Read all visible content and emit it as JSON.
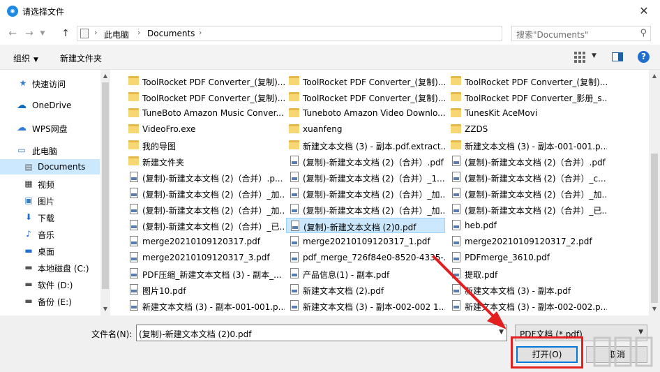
{
  "window": {
    "title": "请选择文件",
    "close_label": "✕"
  },
  "address": {
    "back_icon": "arrow-left-icon",
    "forward_icon": "arrow-right-icon",
    "recent_icon": "chevron-down-icon",
    "up_icon": "arrow-up-icon",
    "crumbs": [
      "此电脑",
      "Documents"
    ],
    "refresh_icon": "refresh-icon"
  },
  "search": {
    "placeholder": "搜索\"Documents\""
  },
  "toolbar": {
    "organize_label": "组织",
    "new_folder_label": "新建文件夹"
  },
  "nav": {
    "items": [
      {
        "label": "快速访问",
        "icon": "star-icon"
      },
      {
        "label": "OneDrive",
        "icon": "cloud-icon"
      },
      {
        "label": "WPS网盘",
        "icon": "cloud-icon"
      },
      {
        "label": "此电脑",
        "icon": "computer-icon"
      },
      {
        "label": "Documents",
        "icon": "document-icon"
      },
      {
        "label": "视频",
        "icon": "video-icon"
      },
      {
        "label": "图片",
        "icon": "picture-icon"
      },
      {
        "label": "下载",
        "icon": "download-icon"
      },
      {
        "label": "音乐",
        "icon": "music-icon"
      },
      {
        "label": "桌面",
        "icon": "desktop-icon"
      },
      {
        "label": "本地磁盘 (C:)",
        "icon": "drive-icon"
      },
      {
        "label": "软件 (D:)",
        "icon": "drive-icon"
      },
      {
        "label": "备份 (E:)",
        "icon": "drive-icon"
      }
    ],
    "selected": "Documents"
  },
  "files": {
    "columns": [
      [
        {
          "name": "ToolRocket PDF Converter_(复制)...",
          "type": "folder"
        },
        {
          "name": "ToolRocket PDF Converter_(复制)...",
          "type": "folder"
        },
        {
          "name": "TuneBoto Amazon Music Conver...",
          "type": "folder"
        },
        {
          "name": "VideoFro.exe",
          "type": "folder"
        },
        {
          "name": "我的导图",
          "type": "folder"
        },
        {
          "name": "新建文件夹",
          "type": "folder"
        },
        {
          "name": "(复制)-新建文本文档 (2)（合并）.p...",
          "type": "pdf"
        },
        {
          "name": "(复制)-新建文本文档 (2)（合并）_加...",
          "type": "pdf"
        },
        {
          "name": "(复制)-新建文本文档 (2)（合并）_加...",
          "type": "pdf"
        },
        {
          "name": "(复制)-新建文本文档 (2)（合并）_已...",
          "type": "pdf"
        },
        {
          "name": "merge20210109120317.pdf",
          "type": "pdf"
        },
        {
          "name": "merge20210109120317_3.pdf",
          "type": "pdf"
        },
        {
          "name": "PDF压缩_新建文本文档 (3) - 副本_...",
          "type": "pdf"
        },
        {
          "name": "图片10.pdf",
          "type": "pdf"
        },
        {
          "name": "新建文本文档 (3) - 副本-001-001.p...",
          "type": "pdf"
        }
      ],
      [
        {
          "name": "ToolRocket PDF Converter_(复制)...",
          "type": "folder"
        },
        {
          "name": "ToolRocket PDF Converter_(复制)...",
          "type": "folder"
        },
        {
          "name": "Tuneboto Amazon Video Downlo...",
          "type": "folder"
        },
        {
          "name": "xuanfeng",
          "type": "folder"
        },
        {
          "name": "新建文本文档 (3) - 副本.pdf.extract...",
          "type": "folder"
        },
        {
          "name": "(复制)-新建文本文档 (2)（合并）.pdf",
          "type": "pdf"
        },
        {
          "name": "(复制)-新建文本文档 (2)（合并）_1...",
          "type": "pdf"
        },
        {
          "name": "(复制)-新建文本文档 (2)（合并）_加...",
          "type": "pdf"
        },
        {
          "name": "(复制)-新建文本文档 (2)（合并）_加...",
          "type": "pdf"
        },
        {
          "name": "(复制)-新建文本文档 (2)0.pdf",
          "type": "pdf"
        },
        {
          "name": "merge20210109120317_1.pdf",
          "type": "pdf"
        },
        {
          "name": "pdf_merge_726f84e0-8520-4335-...",
          "type": "pdf"
        },
        {
          "name": "产品信息(1) - 副本.pdf",
          "type": "pdf"
        },
        {
          "name": "新建文本文档 (2).pdf",
          "type": "pdf"
        },
        {
          "name": "新建文本文档 (3) - 副本-002-002 1...",
          "type": "pdf"
        }
      ],
      [
        {
          "name": "ToolRocket PDF Converter_(复制)...",
          "type": "folder"
        },
        {
          "name": "ToolRocket PDF Converter_影册_s...",
          "type": "folder"
        },
        {
          "name": "TunesKit AceMovi",
          "type": "folder"
        },
        {
          "name": "ZZDS",
          "type": "folder"
        },
        {
          "name": "新建文本文档 (3) - 副本-001-001.p...",
          "type": "folder"
        },
        {
          "name": "(复制)-新建文本文档 (2)（合并）.pdf",
          "type": "pdf"
        },
        {
          "name": "(复制)-新建文本文档 (2)（合并）_c...",
          "type": "pdf"
        },
        {
          "name": "(复制)-新建文本文档 (2)（合并）_加...",
          "type": "pdf"
        },
        {
          "name": "(复制)-新建文本文档 (2)（合并）_已...",
          "type": "pdf"
        },
        {
          "name": "heb.pdf",
          "type": "pdf"
        },
        {
          "name": "merge20210109120317_2.pdf",
          "type": "pdf"
        },
        {
          "name": "PDFmerge_3610.pdf",
          "type": "pdf"
        },
        {
          "name": "提取.pdf",
          "type": "pdf"
        },
        {
          "name": "新建文本文档 (3) - 副本.pdf",
          "type": "pdf"
        },
        {
          "name": "新建文本文档 (3) - 副本-002-002.p...",
          "type": "pdf"
        }
      ]
    ],
    "selected": "(复制)-新建文本文档 (2)0.pdf"
  },
  "bottom": {
    "filename_label": "文件名(N):",
    "filename_value": "(复制)-新建文本文档 (2)0.pdf",
    "filetype_value": "PDF文档 (*.pdf)",
    "open_label": "打开(O)",
    "cancel_label": "取消"
  },
  "colors": {
    "selection": "#cce8ff",
    "annotation": "#e22020",
    "accent": "#0078d7"
  }
}
